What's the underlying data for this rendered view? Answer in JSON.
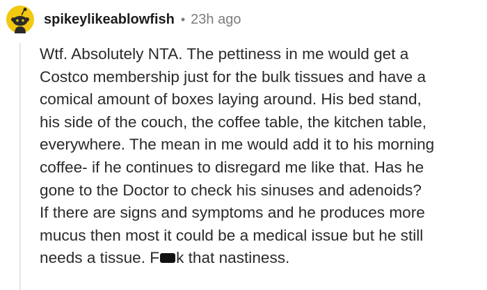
{
  "comment": {
    "avatar_icon": "snoo-avatar-icon",
    "avatar_color": "#f2c811",
    "username": "spikeylikeablowfish",
    "separator": "•",
    "age": "23h ago",
    "body_lines": [
      "Wtf. Absolutely NTA. The pettiness in me would get a",
      "Costco membership just for the bulk tissues and have a",
      "comical amount of boxes laying around. His bed stand,",
      "his side of the couch, the coffee table, the kitchen table,",
      "everywhere. The mean in me would add it to his morning",
      "coffee- if he continues to disregard me like that. Has he",
      "gone to the Doctor to check his sinuses and adenoids?",
      "If there are signs and symptoms and he produces more",
      "mucus then most it could be a medical issue but he still"
    ],
    "last_line_before": "needs a tissue. F",
    "last_line_after": "k that nastiness."
  }
}
